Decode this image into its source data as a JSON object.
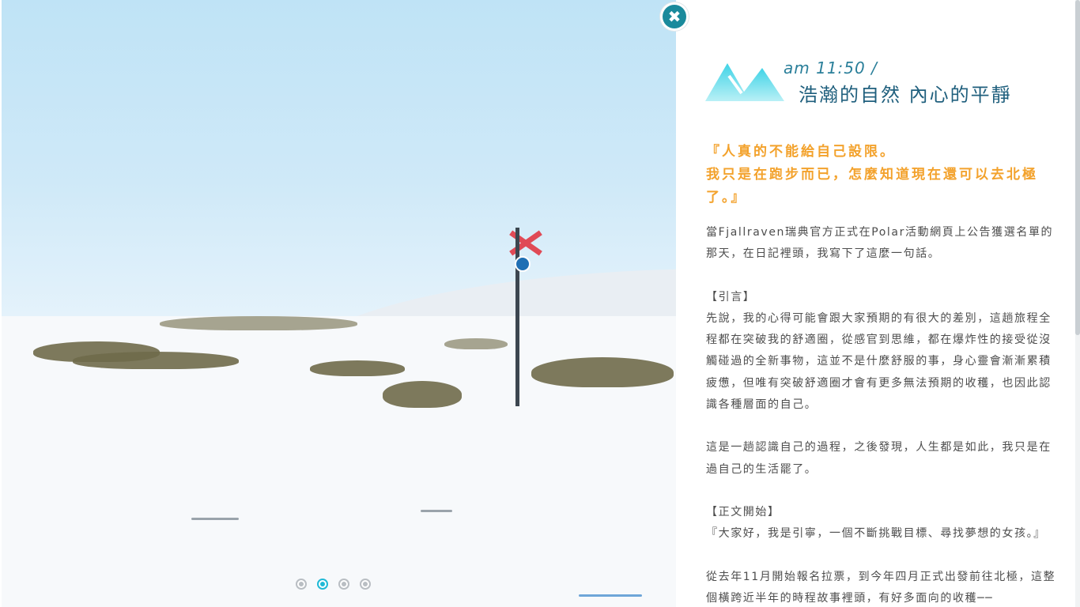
{
  "photo": {
    "alt_subject": "snow-field-with-trail-marker",
    "pager": {
      "count": 4,
      "active_index": 1
    }
  },
  "close_button": {
    "icon": "close-icon",
    "glyph": "✖"
  },
  "header": {
    "time": "am 11:50  /",
    "title": "浩瀚的自然 內心的平靜",
    "logo_icon": "mountain-icon"
  },
  "quote": {
    "line1": "『人真的不能給自己設限。",
    "line2": "我只是在跑步而已，怎麼知道現在還可以去北極了。』"
  },
  "article": {
    "p1": "當Fjallraven瑞典官方正式在Polar活動網頁上公告獲選名單的那天，在日記裡頭，我寫下了這麼一句話。",
    "h1": "【引言】",
    "p2": "先說，我的心得可能會跟大家預期的有很大的差別，這趟旅程全程都在突破我的舒適圈，從感官到思維，都在爆炸性的接受從沒觸碰過的全新事物，這並不是什麼舒服的事，身心靈會漸漸累積疲憊，但唯有突破舒適圈才會有更多無法預期的收穫，也因此認識各種層面的自己。",
    "p3": "這是一趟認識自己的過程，之後發現，人生都是如此，我只是在過自己的生活罷了。",
    "h2": "【正文開始】",
    "p4": "『大家好，我是引寧，一個不斷挑戰目標、尋找夢想的女孩。』",
    "p5": "從去年11月開始報名拉票，到今年四月正式出發前往北極，這整個橫跨近半年的時程故事裡頭，有好多面向的收穫──"
  },
  "colors": {
    "accent_teal": "#1a8a9c",
    "quote_orange": "#f3a22c",
    "title_blue": "#1f5f7d",
    "pager_active": "#20b9d6"
  }
}
